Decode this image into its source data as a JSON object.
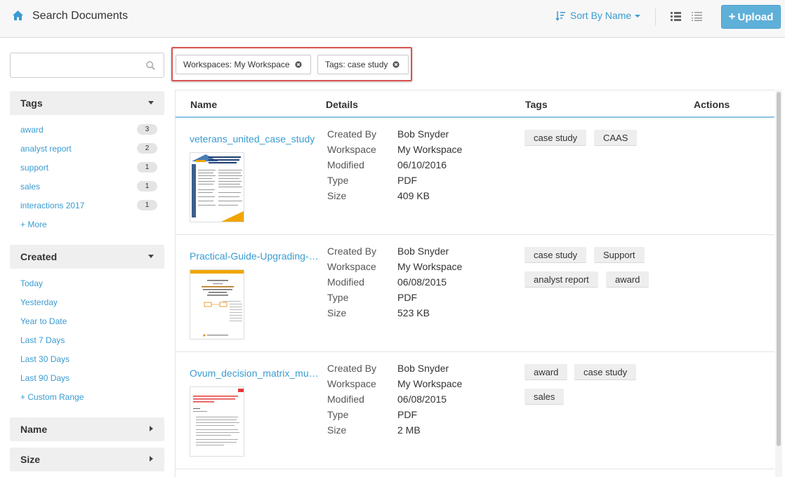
{
  "header": {
    "title": "Search Documents",
    "sort_label": "Sort By Name",
    "upload_label": "Upload"
  },
  "search": {
    "value": "",
    "placeholder": ""
  },
  "facets": {
    "tags": {
      "title": "Tags",
      "items": [
        {
          "label": "award",
          "count": "3"
        },
        {
          "label": "analyst report",
          "count": "2"
        },
        {
          "label": "support",
          "count": "1"
        },
        {
          "label": "sales",
          "count": "1"
        },
        {
          "label": "interactions 2017",
          "count": "1"
        }
      ],
      "more_label": "+ More"
    },
    "created": {
      "title": "Created",
      "items": [
        "Today",
        "Yesterday",
        "Year to Date",
        "Last 7 Days",
        "Last 30 Days",
        "Last 90 Days",
        "+ Custom Range"
      ]
    },
    "name": {
      "title": "Name"
    },
    "size": {
      "title": "Size"
    }
  },
  "filters": [
    {
      "label": "Workspaces: My Workspace"
    },
    {
      "label": "Tags: case study"
    }
  ],
  "table": {
    "headers": {
      "name": "Name",
      "details": "Details",
      "tags": "Tags",
      "actions": "Actions"
    },
    "detail_labels": [
      "Created By",
      "Workspace",
      "Modified",
      "Type",
      "Size"
    ],
    "rows": [
      {
        "name": "veterans_united_case_study",
        "created_by": "Bob Snyder",
        "workspace": "My Workspace",
        "modified": "06/10/2016",
        "type": "PDF",
        "size": "409 KB",
        "tags": [
          "case study",
          "CAAS"
        ]
      },
      {
        "name": "Practical-Guide-Upgrading-CIC",
        "created_by": "Bob Snyder",
        "workspace": "My Workspace",
        "modified": "06/08/2015",
        "type": "PDF",
        "size": "523 KB",
        "tags": [
          "case study",
          "Support",
          "analyst report",
          "award"
        ]
      },
      {
        "name": "Ovum_decision_matrix_multichannel",
        "created_by": "Bob Snyder",
        "workspace": "My Workspace",
        "modified": "06/08/2015",
        "type": "PDF",
        "size": "2 MB",
        "tags": [
          "award",
          "case study",
          "sales"
        ]
      }
    ]
  },
  "colors": {
    "accent": "#3a9bd1",
    "upload_button": "#5fb0d9",
    "highlight_border": "#d9534f"
  },
  "icons": [
    "home-icon",
    "sort-icon",
    "grid-view-icon",
    "list-view-icon",
    "search-icon",
    "remove-filter-icon"
  ]
}
